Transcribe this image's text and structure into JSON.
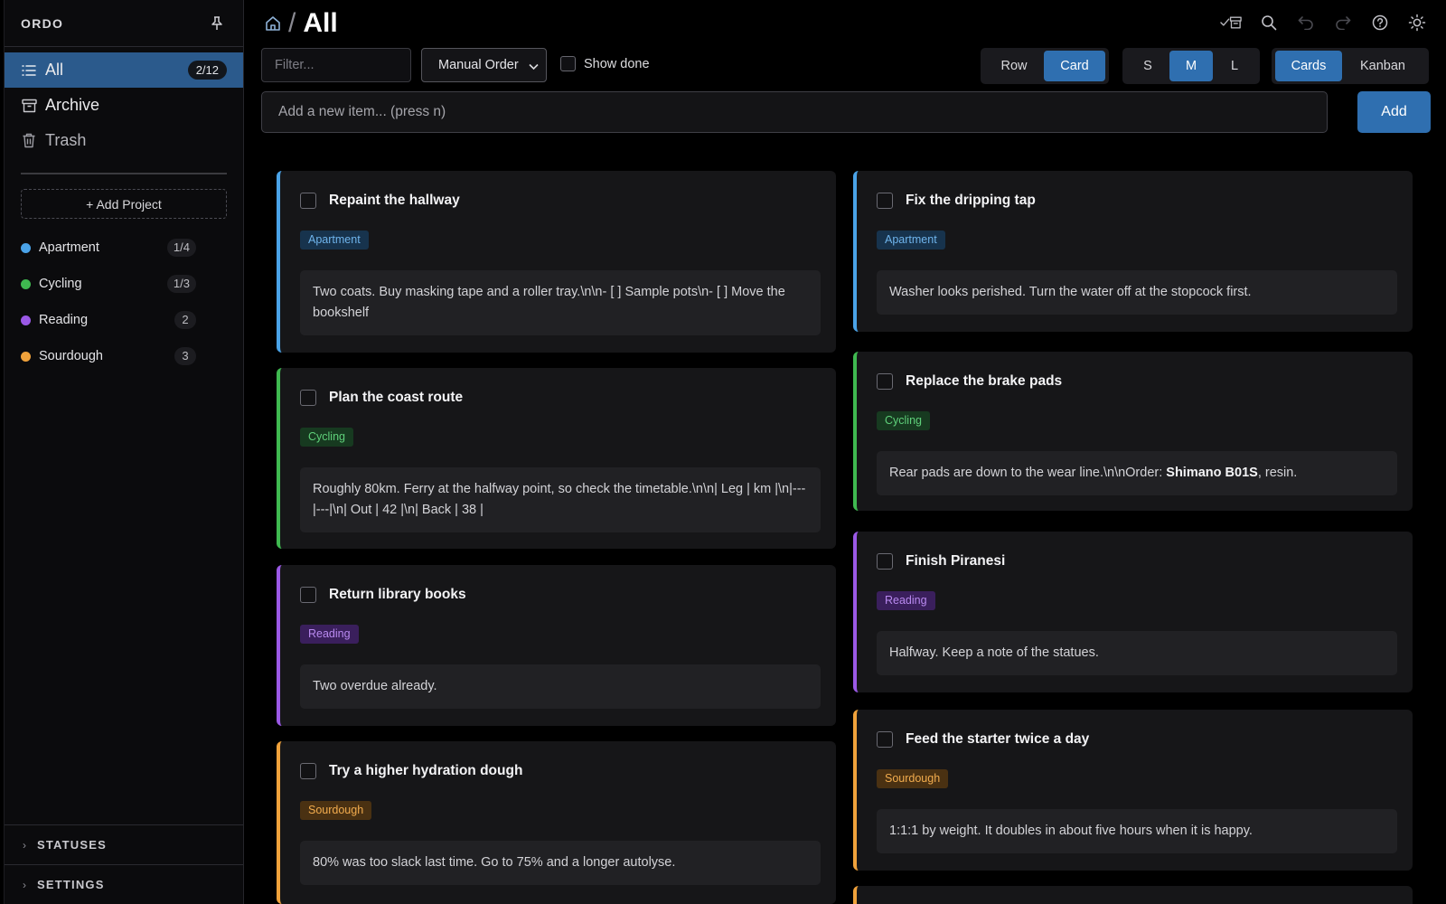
{
  "app": {
    "brand": "ORDO"
  },
  "sidebar": {
    "nav": [
      {
        "label": "All",
        "count": "2/12",
        "icon": "list-icon",
        "active": true
      },
      {
        "label": "Archive",
        "icon": "archive-icon"
      },
      {
        "label": "Trash",
        "icon": "trash-icon"
      }
    ],
    "add_project": "+ Add Project",
    "projects": [
      {
        "label": "Apartment",
        "count": "1/4",
        "color": "#4aa3e8"
      },
      {
        "label": "Cycling",
        "count": "1/3",
        "color": "#3fb950"
      },
      {
        "label": "Reading",
        "count": "2",
        "color": "#9b59e6"
      },
      {
        "label": "Sourdough",
        "count": "3",
        "color": "#f0a23b"
      }
    ],
    "sections": [
      {
        "label": "STATUSES"
      },
      {
        "label": "SETTINGS"
      }
    ]
  },
  "header": {
    "breadcrumb_sep": "/",
    "title": "All",
    "tools": [
      "archive-done-icon",
      "search-icon",
      "undo-icon",
      "redo-icon",
      "help-icon",
      "theme-sun-icon"
    ]
  },
  "controls": {
    "filter_placeholder": "Filter...",
    "sort_value": "Manual Order",
    "show_done": "Show done",
    "layout": {
      "options": [
        "Row",
        "Card"
      ],
      "selected": "Card"
    },
    "size": {
      "options": [
        "S",
        "M",
        "L"
      ],
      "selected": "M"
    },
    "view": {
      "options": [
        "Cards",
        "Kanban"
      ],
      "selected": "Cards"
    },
    "add_placeholder": "Add a new item... (press n)",
    "add_label": "Add"
  },
  "colors": {
    "accent": "#2f6fb0",
    "apartment": "#4aa3e8",
    "cycling": "#3fb950",
    "reading": "#9b59e6",
    "sourdough": "#f0a23b"
  },
  "cards": {
    "left": [
      {
        "title": "Repaint the hallway",
        "tag": "Apartment",
        "note": "Two coats. Buy masking tape and a roller tray.\\n\\n- [ ] Sample pots\\n- [ ] Move the bookshelf"
      },
      {
        "title": "Plan the coast route",
        "tag": "Cycling",
        "note": "Roughly 80km. Ferry at the halfway point, so check the timetable.\\n\\n| Leg | km |\\n|---|---|\\n| Out | 42 |\\n| Back | 38 |"
      },
      {
        "title": "Return library books",
        "tag": "Reading",
        "note": "Two overdue already."
      },
      {
        "title": "Try a higher hydration dough",
        "tag": "Sourdough",
        "note": "80% was too slack last time. Go to 75% and a longer autolyse."
      }
    ],
    "right": [
      {
        "title": "Fix the dripping tap",
        "tag": "Apartment",
        "note": "Washer looks perished. Turn the water off at the stopcock first."
      },
      {
        "title": "Replace the brake pads",
        "tag": "Cycling",
        "note_before": "Rear pads are down to the wear line.\\n\\nOrder: ",
        "note_bold": "Shimano B01S",
        "note_after": ", resin."
      },
      {
        "title": "Finish Piranesi",
        "tag": "Reading",
        "note": "Halfway. Keep a note of the statues."
      },
      {
        "title": "Feed the starter twice a day",
        "tag": "Sourdough",
        "note": "1:1:1 by weight. It doubles in about five hours when it is happy."
      }
    ]
  }
}
